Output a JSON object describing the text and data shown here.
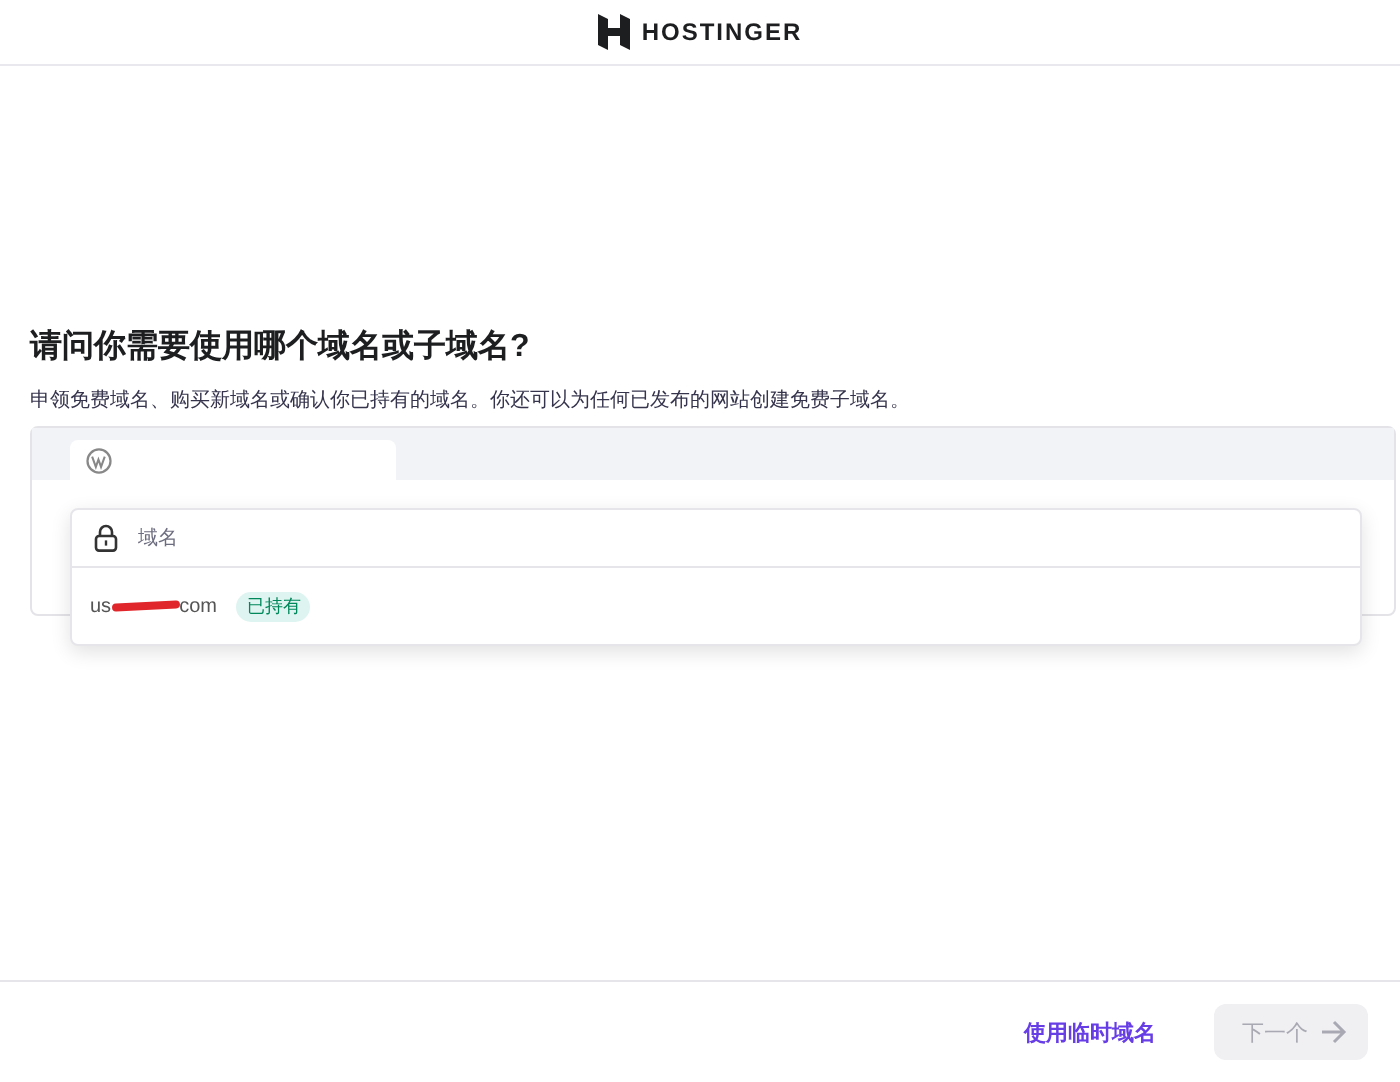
{
  "header": {
    "logo_text": "HOSTINGER"
  },
  "heading": "请问你需要使用哪个域名或子域名?",
  "subtitle": "申领免费域名、购买新域名或确认你已持有的域名。你还可以为任何已发布的网站创建免费子域名。",
  "domain_field": {
    "placeholder": "域名"
  },
  "options": [
    {
      "domain_start": "us",
      "domain_end": "com",
      "badge": "已持有",
      "redacted": true
    }
  ],
  "footer": {
    "link": "使用临时域名",
    "next_button": {
      "label": "下一个",
      "disabled": true
    }
  }
}
